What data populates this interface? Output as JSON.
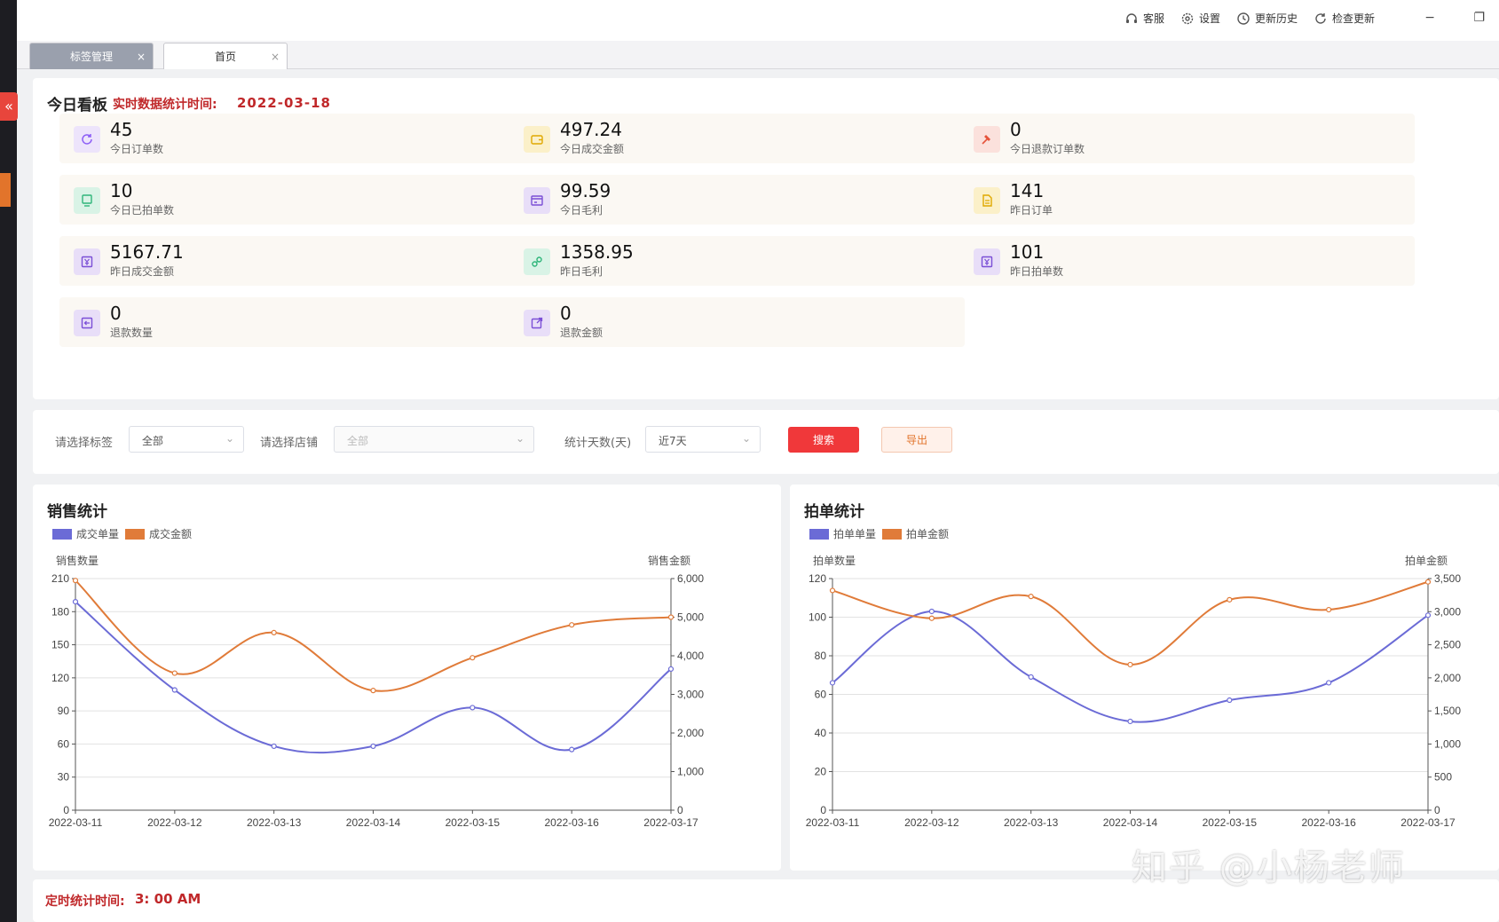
{
  "titlebar": {
    "actions": [
      {
        "label": "客服",
        "icon": "headset-icon"
      },
      {
        "label": "设置",
        "icon": "gear-icon"
      },
      {
        "label": "更新历史",
        "icon": "history-icon"
      },
      {
        "label": "检查更新",
        "icon": "refresh-icon"
      }
    ],
    "minimize": "−",
    "restore": "❐"
  },
  "sidebar": {
    "collapse": "«"
  },
  "tabs": [
    {
      "label": "标签管理",
      "close": "×",
      "active": false
    },
    {
      "label": "首页",
      "close": "×",
      "active": true
    }
  ],
  "dashboard": {
    "title": "今日看板",
    "subtitle": "实时数据统计时间:",
    "date": "2022-03-18",
    "cards": [
      {
        "value": "45",
        "label": "今日订单数",
        "icon": "refresh-icon",
        "color": "#8b5cf6",
        "bg": "#ede4fb"
      },
      {
        "value": "497.24",
        "label": "今日成交金额",
        "icon": "wallet-icon",
        "color": "#e0a800",
        "bg": "#fbf0c9"
      },
      {
        "value": "0",
        "label": "今日退款订单数",
        "icon": "hammer-icon",
        "color": "#e5533a",
        "bg": "#fbe1dc"
      },
      {
        "value": "10",
        "label": "今日已拍单数",
        "icon": "monitor-icon",
        "color": "#2fb57a",
        "bg": "#d9f3e6"
      },
      {
        "value": "99.59",
        "label": "今日毛利",
        "icon": "card-icon",
        "color": "#7b4fd6",
        "bg": "#e8def8"
      },
      {
        "value": "141",
        "label": "昨日订单",
        "icon": "document-icon",
        "color": "#e0a800",
        "bg": "#fbf0c9"
      },
      {
        "value": "5167.71",
        "label": "昨日成交金额",
        "icon": "yen-icon",
        "color": "#7b4fd6",
        "bg": "#e8def8"
      },
      {
        "value": "1358.95",
        "label": "昨日毛利",
        "icon": "link-icon",
        "color": "#2fb57a",
        "bg": "#d9f3e6"
      },
      {
        "value": "101",
        "label": "昨日拍单数",
        "icon": "yen-icon",
        "color": "#7b4fd6",
        "bg": "#e8def8"
      },
      {
        "value": "0",
        "label": "退款数量",
        "icon": "return-icon",
        "color": "#7b4fd6",
        "bg": "#e8def8"
      },
      {
        "value": "0",
        "label": "退款金额",
        "icon": "external-icon",
        "color": "#7b4fd6",
        "bg": "#e8def8"
      }
    ]
  },
  "filters": {
    "tag_label": "请选择标签",
    "tag_value": "全部",
    "shop_label": "请选择店铺",
    "shop_placeholder": "全部",
    "days_label": "统计天数(天)",
    "days_value": "近7天",
    "search": "搜索",
    "export": "导出"
  },
  "chart_data": [
    {
      "type": "line",
      "title": "销售统计",
      "categories": [
        "2022-03-11",
        "2022-03-12",
        "2022-03-13",
        "2022-03-14",
        "2022-03-15",
        "2022-03-16",
        "2022-03-17"
      ],
      "ylabel_left": "销售数量",
      "ylabel_right": "销售金额",
      "ylim_left": [
        0,
        210
      ],
      "yticks_left": [
        "0",
        "30",
        "60",
        "90",
        "120",
        "150",
        "180",
        "210"
      ],
      "ylim_right": [
        0,
        6000
      ],
      "yticks_right": [
        "0",
        "1,000",
        "2,000",
        "3,000",
        "4,000",
        "5,000",
        "6,000"
      ],
      "legend_position": "top-left",
      "grid": true,
      "series": [
        {
          "name": "成交单量",
          "axis": "left",
          "color": "#6b6bd6",
          "values": [
            189,
            109,
            58,
            58,
            93,
            55,
            128
          ]
        },
        {
          "name": "成交金额",
          "axis": "right",
          "color": "#e07b39",
          "values": [
            5950,
            3550,
            4600,
            3100,
            3950,
            4800,
            5000
          ]
        }
      ]
    },
    {
      "type": "line",
      "title": "拍单统计",
      "categories": [
        "2022-03-11",
        "2022-03-12",
        "2022-03-13",
        "2022-03-14",
        "2022-03-15",
        "2022-03-16",
        "2022-03-17"
      ],
      "ylabel_left": "拍单数量",
      "ylabel_right": "拍单金额",
      "ylim_left": [
        0,
        120
      ],
      "yticks_left": [
        "0",
        "20",
        "40",
        "60",
        "80",
        "100",
        "120"
      ],
      "ylim_right": [
        0,
        3500
      ],
      "yticks_right": [
        "0",
        "500",
        "1,000",
        "1,500",
        "2,000",
        "2,500",
        "3,000",
        "3,500"
      ],
      "legend_position": "top-left",
      "grid": true,
      "series": [
        {
          "name": "拍单单量",
          "axis": "left",
          "color": "#6b6bd6",
          "values": [
            66,
            103,
            69,
            46,
            57,
            66,
            101
          ]
        },
        {
          "name": "拍单金额",
          "axis": "right",
          "color": "#e07b39",
          "values": [
            3320,
            2900,
            3230,
            2200,
            3180,
            3030,
            3450
          ]
        }
      ]
    }
  ],
  "bottom": {
    "label": "定时统计时间:",
    "time": "3: 00 AM"
  },
  "watermark": "知乎 @小杨老师"
}
